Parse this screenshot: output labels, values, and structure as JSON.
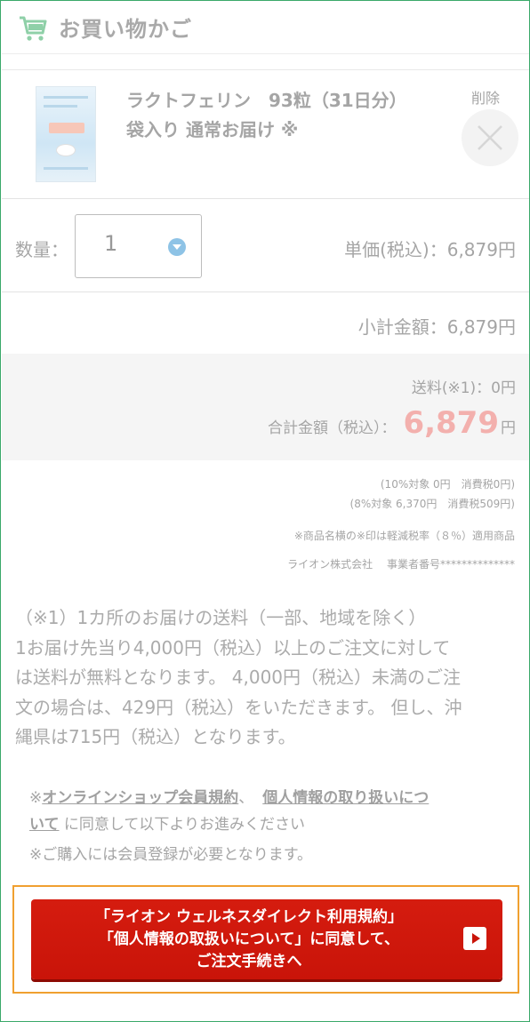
{
  "header": {
    "title": "お買い物かご",
    "icon": "cart-icon"
  },
  "colors": {
    "accent_green": "#3aa96a",
    "cta_red": "#c91409",
    "total_pink": "#f3b0ad",
    "cta_border": "#f0a030"
  },
  "product": {
    "name_line1": "ラクトフェリン　93粒（31日分）",
    "name_line2": "袋入り 通常お届け ※",
    "delete_label": "削除"
  },
  "quantity": {
    "label": "数量：",
    "value": "1"
  },
  "prices": {
    "unit_price": "単価(税込)：6,879円",
    "subtotal": "小計金額：6,879円",
    "shipping": "送料(※1)：0円",
    "total_label": "合計金額（税込）：",
    "total_amount": "6,879",
    "total_yen": "円"
  },
  "tax": {
    "line1": "(10%対象 0円　消費税0円)",
    "line2": "(8%対象 6,370円　消費税509円)",
    "reduced_note": "※商品名横の※印は軽減税率（８％）適用商品",
    "company": "ライオン株式会社　 事業者番号**************"
  },
  "shipping_note": {
    "line1": "（※1）1カ所のお届けの送料（一部、地域を除く）",
    "line2": "1お届け先当り4,000円（税込）以上のご注文に対して",
    "line3": "は送料が無料となります。 4,000円（税込）未満のご注",
    "line4": "文の場合は、429円（税込）をいただきます。 但し、沖",
    "line5": "縄県は715円（税込）となります。"
  },
  "consent": {
    "prefix": "※",
    "link1": "オンラインショップ会員規約",
    "sep": "、",
    "link2_a": "個人情報の取り扱いにつ",
    "link2_b": "いて",
    "suffix": " に同意して以下よりお進みください",
    "member_note": "※ご購入には会員登録が必要となります。"
  },
  "cta": {
    "line1": "「ライオン ウェルネスダイレクト利用規約」",
    "line2": "「個人情報の取扱いについて」に同意して、",
    "line3": "ご注文手続きへ"
  }
}
